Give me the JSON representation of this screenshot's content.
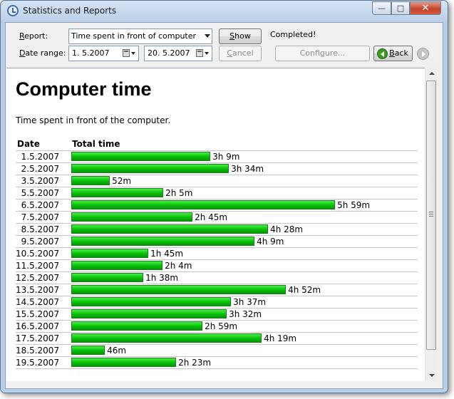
{
  "window": {
    "title": "Statistics and Reports",
    "controls": {
      "minimize": "—",
      "maximize": "□",
      "close": "✕"
    }
  },
  "toolbar": {
    "report_label_prefix": "R",
    "report_label_rest": "eport:",
    "report_selected": "Time spent in front of computer",
    "date_range_label_prefix": "D",
    "date_range_label_rest": "ate range:",
    "date_from": "1.  5.2007",
    "date_to": "20.  5.2007",
    "show_button_prefix": "S",
    "show_button_rest": "how",
    "cancel_button_prefix": "C",
    "cancel_button_rest": "ancel",
    "configure_button": "Configure...",
    "back_button_prefix": "B",
    "back_button_rest": "ack",
    "status": "Completed!"
  },
  "report": {
    "title": "Computer time",
    "subtitle": "Time spent in front of the computer.",
    "columns": [
      "Date",
      "Total time"
    ]
  },
  "chart_data": {
    "type": "bar",
    "title": "Computer time",
    "categories": [
      "1.5.2007",
      "2.5.2007",
      "3.5.2007",
      "5.5.2007",
      "6.5.2007",
      "7.5.2007",
      "8.5.2007",
      "9.5.2007",
      "10.5.2007",
      "11.5.2007",
      "12.5.2007",
      "13.5.2007",
      "14.5.2007",
      "15.5.2007",
      "16.5.2007",
      "17.5.2007",
      "18.5.2007",
      "19.5.2007"
    ],
    "labels": [
      "3h 9m",
      "3h 34m",
      "52m",
      "2h 5m",
      "5h 59m",
      "2h 45m",
      "4h 28m",
      "4h 9m",
      "1h 45m",
      "2h 4m",
      "1h 38m",
      "4h 52m",
      "3h 37m",
      "3h 32m",
      "2h 59m",
      "4h 19m",
      "46m",
      "2h 23m"
    ],
    "values": [
      189,
      214,
      52,
      125,
      359,
      165,
      268,
      249,
      105,
      124,
      98,
      292,
      217,
      212,
      179,
      259,
      46,
      143
    ],
    "unit": "minutes",
    "colors": {
      "bar_top": "#48f048",
      "bar_mid": "#0bc20b",
      "bar_bottom": "#069706",
      "bar_border": "#1d7d1d"
    }
  }
}
